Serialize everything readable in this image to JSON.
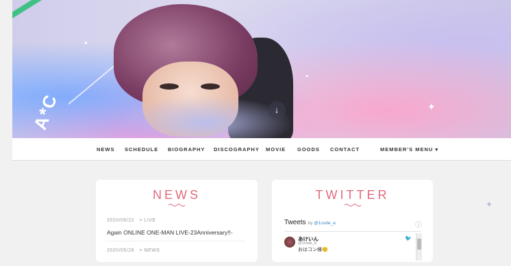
{
  "hero": {
    "logo_text": "A*C",
    "scroll_icon": "down-arrow-icon",
    "scroll_glyph": "↓"
  },
  "nav": {
    "items": [
      "NEWS",
      "SCHEDULE",
      "BIOGRAPHY",
      "DISCOGRAPHY",
      "MOVIE",
      "GOODS",
      "CONTACT"
    ],
    "member_menu": "MEMBER'S MENU ▾"
  },
  "news": {
    "title": "NEWS",
    "items": [
      {
        "date": "2020/06/22",
        "category": "> LIVE",
        "title": "Again ONLINE ONE-MAN LIVE-23Anniversary!!-"
      },
      {
        "date": "2020/05/26",
        "category": "> NEWS",
        "title": ""
      }
    ]
  },
  "twitter": {
    "title": "TWITTER",
    "tweets_label": "Tweets",
    "by_label": "by",
    "handle_link": "@1code_a",
    "info_glyph": "ⓘ",
    "tweet": {
      "name": "あけいん",
      "handle": "@1code_a",
      "text": "おはコン様😊"
    }
  },
  "colors": {
    "accent": "#e06b7c",
    "nav_text": "#333333",
    "link": "#3a86c8",
    "background": "#f1f1f2"
  }
}
